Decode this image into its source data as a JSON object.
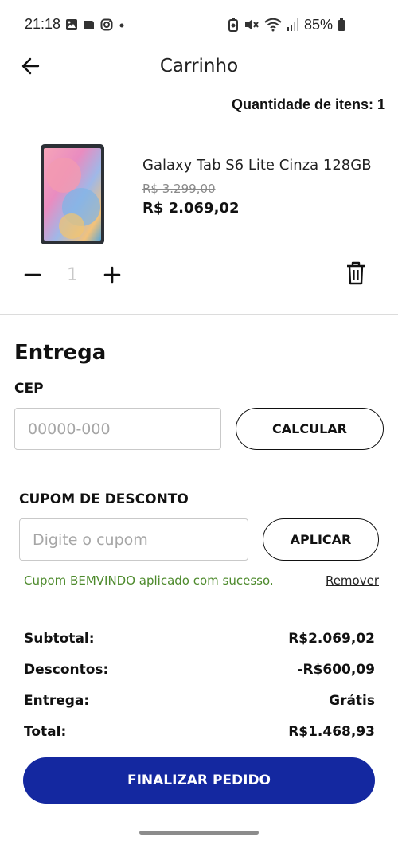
{
  "status_bar": {
    "time": "21:18",
    "left_icons": [
      "gallery-icon",
      "notification-app-icon",
      "instagram-icon",
      "dot-icon"
    ],
    "right_icons": [
      "data-saver-icon",
      "mute-icon",
      "wifi-icon",
      "signal-icon",
      "battery-icon"
    ],
    "battery": "85%"
  },
  "header": {
    "title": "Carrinho",
    "back_icon": "arrow-left-icon"
  },
  "cart": {
    "item_count_label": "Quantidade de itens: 1",
    "product": {
      "name": "Galaxy Tab S6 Lite Cinza 128GB",
      "old_price": "R$ 3.299,00",
      "price": "R$ 2.069,02",
      "quantity": "1"
    }
  },
  "delivery": {
    "title": "Entrega",
    "cep_label": "CEP",
    "cep_placeholder": "00000-000",
    "calculate_label": "CALCULAR"
  },
  "coupon": {
    "label": "CUPOM DE DESCONTO",
    "placeholder": "Digite o cupom",
    "apply_label": "APLICAR",
    "success_message": "Cupom BEMVINDO aplicado com sucesso.",
    "remove_label": "Remover"
  },
  "summary": {
    "rows": [
      {
        "label": "Subtotal:",
        "value": "R$2.069,02"
      },
      {
        "label": "Descontos:",
        "value": "-R$600,09"
      },
      {
        "label": "Entrega:",
        "value": "Grátis"
      },
      {
        "label": "Total:",
        "value": "R$1.468,93"
      }
    ]
  },
  "checkout": {
    "button_label": "FINALIZAR PEDIDO"
  },
  "colors": {
    "primary": "#1428a0",
    "success": "#4d8a2c",
    "old_price": "#8a8a8a"
  }
}
